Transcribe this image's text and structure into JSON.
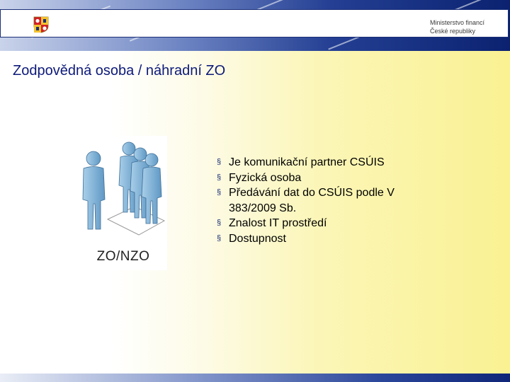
{
  "header": {
    "org_line1": "Ministerstvo financí",
    "org_line2": "České republiky",
    "emblem_icon": "czech-coat-of-arms-icon"
  },
  "slide": {
    "title": "Zodpovědná osoba / náhradní ZO",
    "figure": {
      "icon": "people-group-icon",
      "label": "ZO/NZO"
    },
    "bullets": [
      "Je komunikační partner CSÚIS",
      "Fyzická osoba",
      "Předávání dat do CSÚIS podle V 383/2009 Sb.",
      "Znalost IT prostředí",
      "Dostupnost"
    ],
    "bullet_glyph": "§"
  },
  "colors": {
    "title": "#0d1a7a",
    "banner_dark": "#0b2270",
    "figure_blue": "#7fb3d8"
  }
}
